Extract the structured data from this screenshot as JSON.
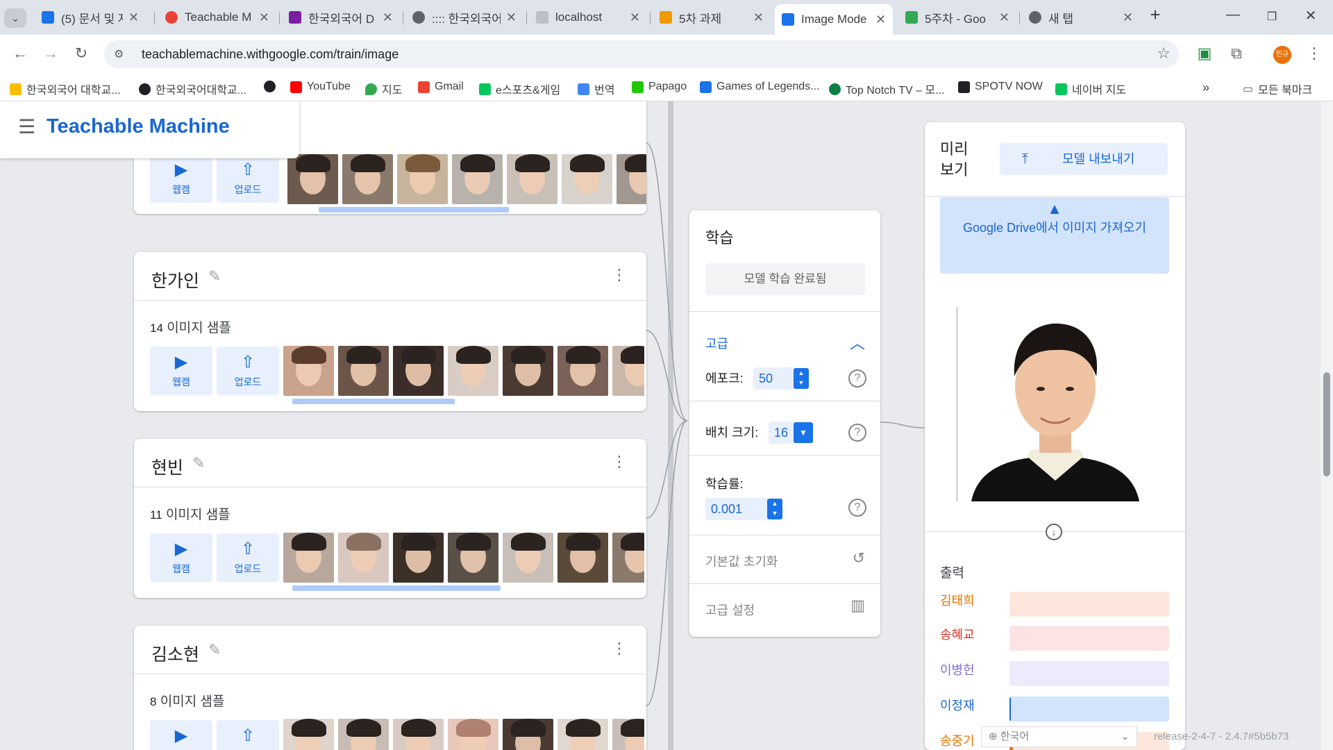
{
  "browser": {
    "tabs": [
      {
        "title": "(5) 문서 및 자",
        "color": "#1a73e8"
      },
      {
        "title": "Teachable M",
        "color": "#ea4335"
      },
      {
        "title": "한국외국어 D",
        "color": "#7b1fa2"
      },
      {
        "title": ":::: 한국외국어",
        "color": "#5f6368"
      },
      {
        "title": "localhost",
        "color": "#bdc1c6"
      },
      {
        "title": "5차 과제",
        "color": "#f29900"
      },
      {
        "title": "Image Mode",
        "color": "#1a73e8"
      },
      {
        "title": "5주차 - Goo",
        "color": "#34a853"
      },
      {
        "title": "새 탭",
        "color": "#5f6368"
      }
    ],
    "url": "teachablemachine.withgoogle.com/train/image",
    "bookmarks": [
      {
        "label": "한국외국어 대학교...",
        "color": "#fbbc04"
      },
      {
        "label": "한국외국어대학교...",
        "color": "#202124"
      },
      {
        "label": "",
        "color": "#202124"
      },
      {
        "label": "YouTube",
        "color": "#ff0000"
      },
      {
        "label": "지도",
        "color": "#34a853"
      },
      {
        "label": "Gmail",
        "color": "#ea4335"
      },
      {
        "label": "e스포츠&게임",
        "color": "#03c75a"
      },
      {
        "label": "번역",
        "color": "#4285f4"
      },
      {
        "label": "Papago",
        "color": "#1ec800"
      },
      {
        "label": "Games of Legends...",
        "color": "#1a73e8"
      },
      {
        "label": "Top Notch TV – 모...",
        "color": "#0b8043"
      },
      {
        "label": "SPOTV NOW",
        "color": "#202124"
      },
      {
        "label": "네이버 지도",
        "color": "#03c75a"
      }
    ],
    "all_bookmarks": "모든 북마크",
    "profile": "민규"
  },
  "app": {
    "brand": "Teachable Machine",
    "webcam_label": "웹캠",
    "upload_label": "업로드",
    "samples_suffix": "이미지 샘플",
    "classes": [
      {
        "name": "한가인",
        "count": "14"
      },
      {
        "name": "현빈",
        "count": "11"
      },
      {
        "name": "김소현",
        "count": "8"
      }
    ],
    "training": {
      "title": "학습",
      "trained_button": "모델 학습 완료됨",
      "advanced": "고급",
      "epochs_label": "에포크:",
      "epochs": "50",
      "batch_label": "배치 크기:",
      "batch": "16",
      "lr_label": "학습률:",
      "lr": "0.001",
      "reset": "기본값 초기화",
      "adv_settings": "고급 설정"
    },
    "preview": {
      "title": "미리 보기",
      "export": "모델 내보내기",
      "gdrive_brand": "Google Drive",
      "gdrive_text": "에서 이미지 가져오기",
      "output_title": "출력",
      "outputs": [
        {
          "name": "김태희",
          "color": "#e37400",
          "bg": "#fde7dc",
          "value": 0
        },
        {
          "name": "송혜교",
          "color": "#d93025",
          "bg": "#fce4e4",
          "value": 0
        },
        {
          "name": "이병헌",
          "color": "#7b6fd0",
          "bg": "#ecebfb",
          "value": 0
        },
        {
          "name": "이정재",
          "color": "#1967d2",
          "bg": "#d2e3fc",
          "value": 0.01
        },
        {
          "name": "송중기",
          "color": "#e37400",
          "bg": "#fde7dc",
          "value": 0.02
        }
      ]
    },
    "language": "한국어",
    "release": "release-2-4-7 - 2.4.7#5b5b73"
  }
}
